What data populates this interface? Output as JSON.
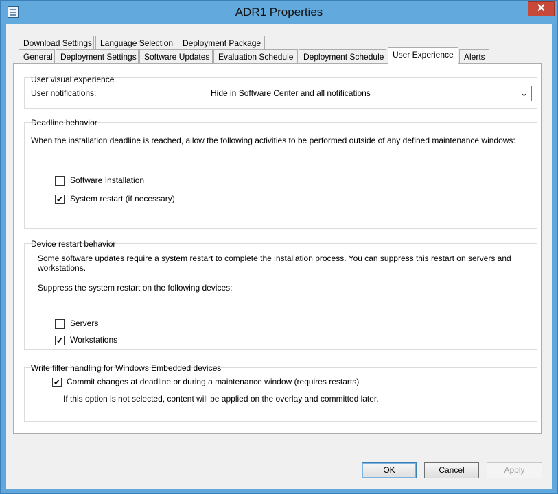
{
  "window": {
    "title": "ADR1 Properties",
    "close_glyph": "✕"
  },
  "tabs": {
    "row1": [
      "Download Settings",
      "Language Selection",
      "Deployment Package"
    ],
    "row2": [
      "General",
      "Deployment Settings",
      "Software Updates",
      "Evaluation Schedule",
      "Deployment Schedule",
      "User Experience",
      "Alerts"
    ],
    "active": "User Experience"
  },
  "user_visual": {
    "title": "User visual experience",
    "notifications_label": "User notifications:",
    "notifications_value": "Hide in Software Center and all notifications",
    "chevron": "⌄"
  },
  "deadline": {
    "title": "Deadline behavior",
    "description": "When the installation deadline is reached, allow the following activities to be performed outside of any defined maintenance windows:",
    "software_installation": {
      "label": "Software Installation",
      "checked": false
    },
    "system_restart": {
      "label": "System restart (if necessary)",
      "checked": true
    }
  },
  "device_restart": {
    "title": "Device restart behavior",
    "description_line1": "Some software updates require a system restart to complete the installation process. You can suppress this restart on servers and",
    "description_line2": "workstations.",
    "suppress_label": "Suppress the system restart on the following devices:",
    "servers": {
      "label": "Servers",
      "checked": false
    },
    "workstations": {
      "label": "Workstations",
      "checked": true
    }
  },
  "write_filter": {
    "title": "Write filter handling for Windows Embedded devices",
    "commit": {
      "label": "Commit changes at deadline or during a maintenance window (requires restarts)",
      "checked": true
    },
    "note": "If this option is not selected, content will be applied on the overlay and committed later."
  },
  "buttons": {
    "ok": "OK",
    "cancel": "Cancel",
    "apply": "Apply"
  },
  "check_glyph": "✔"
}
